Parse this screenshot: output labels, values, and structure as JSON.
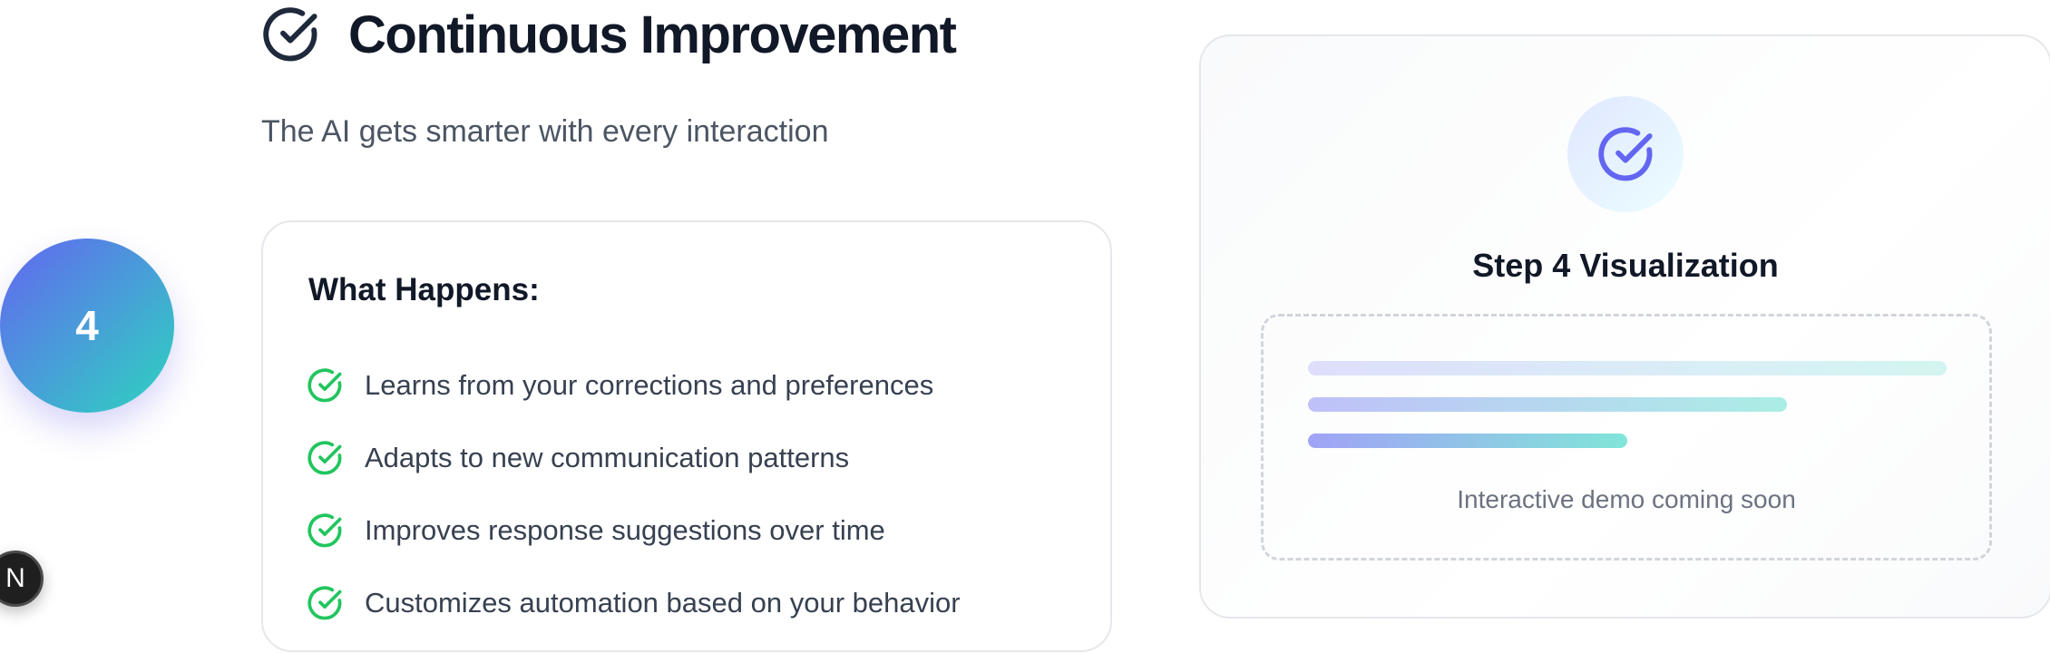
{
  "step": {
    "number": "4",
    "icon": "check-circle-icon"
  },
  "header": {
    "title": "Continuous Improvement",
    "subtitle": "The AI gets smarter with every interaction",
    "icon": "check-circle-icon"
  },
  "what_happens": {
    "title": "What Happens:",
    "items": [
      {
        "text": "Learns from your corrections and preferences",
        "icon": "check-circle-icon"
      },
      {
        "text": "Adapts to new communication patterns",
        "icon": "check-circle-icon"
      },
      {
        "text": "Improves response suggestions over time",
        "icon": "check-circle-icon"
      },
      {
        "text": "Customizes automation based on your behavior",
        "icon": "check-circle-icon"
      }
    ]
  },
  "visualization": {
    "title": "Step 4 Visualization",
    "caption": "Interactive demo coming soon",
    "icon": "check-circle-icon"
  },
  "dev_badge": {
    "label": "N"
  },
  "colors": {
    "accent_indigo": "#6366f1",
    "accent_teal": "#2dd4bf",
    "check_green": "#22c55e",
    "title_navy": "#1e293b"
  }
}
